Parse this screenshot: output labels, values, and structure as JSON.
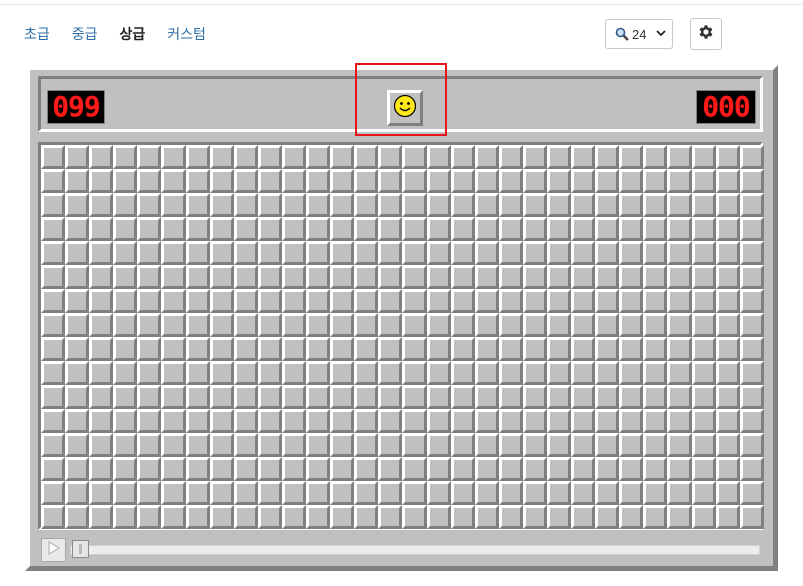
{
  "levels": [
    {
      "label": "초급",
      "active": false
    },
    {
      "label": "중급",
      "active": false
    },
    {
      "label": "상급",
      "active": true
    },
    {
      "label": "커스텀",
      "active": false
    }
  ],
  "zoom": {
    "value": "24"
  },
  "game": {
    "mines_counter": "099",
    "timer": "000",
    "face": "smiley",
    "columns": 30,
    "rows": 16
  },
  "colors": {
    "counter_digit": "#ff1a1a",
    "board": "#c0c0c0",
    "highlight": "#e8141a"
  }
}
